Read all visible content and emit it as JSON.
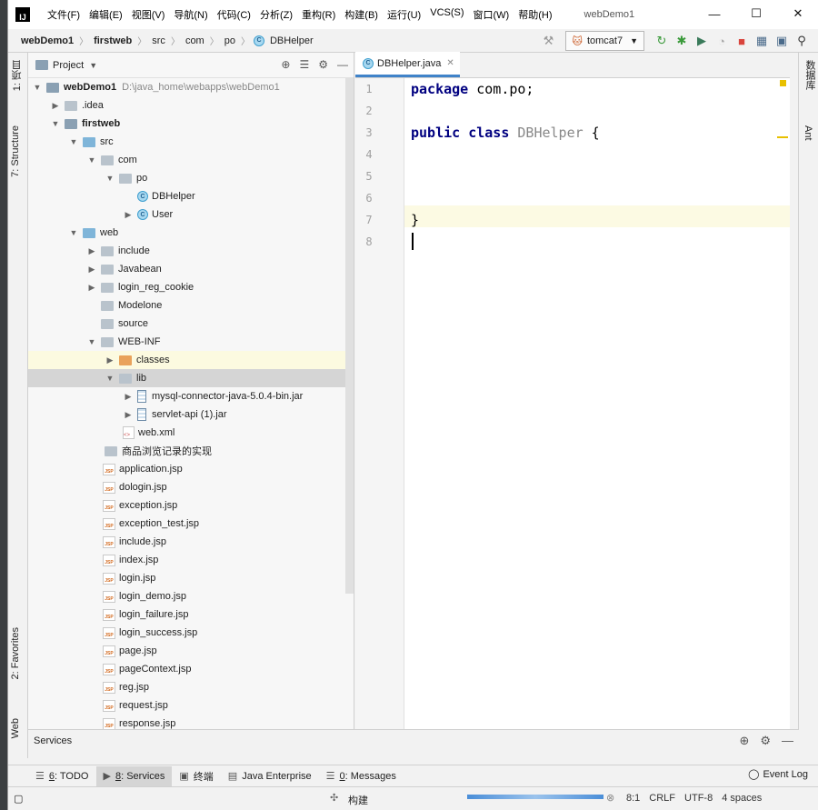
{
  "app": {
    "logo": "IJ",
    "window_title": "webDemo1",
    "menu": [
      "文件(F)",
      "编辑(E)",
      "视图(V)",
      "导航(N)",
      "代码(C)",
      "分析(Z)",
      "重构(R)",
      "构建(B)",
      "运行(U)",
      "VCS(S)",
      "窗口(W)",
      "帮助(H)"
    ],
    "window_controls": {
      "minimize": "—",
      "maximize": "☐",
      "close": "✕"
    }
  },
  "navbar": {
    "breadcrumb": [
      "webDemo1",
      "firstweb",
      "src",
      "com",
      "po",
      "DBHelper"
    ],
    "run_config": "tomcat7"
  },
  "left_strip": {
    "project_tab": "1: 项目",
    "structure_tab": "7: Structure",
    "favorites_tab": "2: Favorites",
    "web_tab": "Web"
  },
  "right_strip": {
    "database_tab": "数据库",
    "ant_tab": "Ant"
  },
  "project_panel": {
    "title": "Project",
    "root_path": "D:\\java_home\\webapps\\webDemo1",
    "tree": [
      {
        "label": "webDemo1",
        "icon": "module"
      },
      {
        "label": ".idea",
        "icon": "folder"
      },
      {
        "label": "firstweb",
        "icon": "module"
      },
      {
        "label": "src",
        "icon": "source-folder"
      },
      {
        "label": "com",
        "icon": "package"
      },
      {
        "label": "po",
        "icon": "package"
      },
      {
        "label": "DBHelper",
        "icon": "class"
      },
      {
        "label": "User",
        "icon": "class"
      },
      {
        "label": "web",
        "icon": "web-folder"
      },
      {
        "label": "include",
        "icon": "folder"
      },
      {
        "label": "Javabean",
        "icon": "folder"
      },
      {
        "label": "login_reg_cookie",
        "icon": "folder"
      },
      {
        "label": "Modelone",
        "icon": "folder"
      },
      {
        "label": "source",
        "icon": "folder"
      },
      {
        "label": "WEB-INF",
        "icon": "folder"
      },
      {
        "label": "classes",
        "icon": "excluded-folder"
      },
      {
        "label": "lib",
        "icon": "folder"
      },
      {
        "label": "mysql-connector-java-5.0.4-bin.jar",
        "icon": "jar"
      },
      {
        "label": "servlet-api (1).jar",
        "icon": "jar"
      },
      {
        "label": "web.xml",
        "icon": "xml"
      },
      {
        "label": "商品浏览记录的实现",
        "icon": "folder"
      },
      {
        "label": "application.jsp",
        "icon": "jsp"
      },
      {
        "label": "dologin.jsp",
        "icon": "jsp"
      },
      {
        "label": "exception.jsp",
        "icon": "jsp"
      },
      {
        "label": "exception_test.jsp",
        "icon": "jsp"
      },
      {
        "label": "include.jsp",
        "icon": "jsp"
      },
      {
        "label": "index.jsp",
        "icon": "jsp"
      },
      {
        "label": "login.jsp",
        "icon": "jsp"
      },
      {
        "label": "login_demo.jsp",
        "icon": "jsp"
      },
      {
        "label": "login_failure.jsp",
        "icon": "jsp"
      },
      {
        "label": "login_success.jsp",
        "icon": "jsp"
      },
      {
        "label": "page.jsp",
        "icon": "jsp"
      },
      {
        "label": "pageContext.jsp",
        "icon": "jsp"
      },
      {
        "label": "reg.jsp",
        "icon": "jsp"
      },
      {
        "label": "request.jsp",
        "icon": "jsp"
      },
      {
        "label": "response.jsp",
        "icon": "jsp"
      }
    ]
  },
  "editor": {
    "tab": "DBHelper.java",
    "line_numbers": [
      "1",
      "2",
      "3",
      "4",
      "5",
      "6",
      "7",
      "8"
    ],
    "code": {
      "l1_kw": "package",
      "l1_rest": " com.po;",
      "l3_kw1": "public",
      "l3_kw2": "class",
      "l3_name": "DBHelper",
      "l3_brace": " {",
      "l7": "}"
    }
  },
  "services": {
    "title": "Services"
  },
  "bottom_tools": {
    "todo": {
      "num": "6",
      "label": ": TODO"
    },
    "services": {
      "num": "8",
      "label": ": Services"
    },
    "terminal": "终端",
    "java_enterprise": "Java Enterprise",
    "messages": {
      "num": "0",
      "label": ": Messages"
    },
    "event_log": "Event Log"
  },
  "status": {
    "build_text": "构建",
    "position": "8:1",
    "line_sep": "CRLF",
    "encoding": "UTF-8",
    "indent": "4 spaces"
  }
}
